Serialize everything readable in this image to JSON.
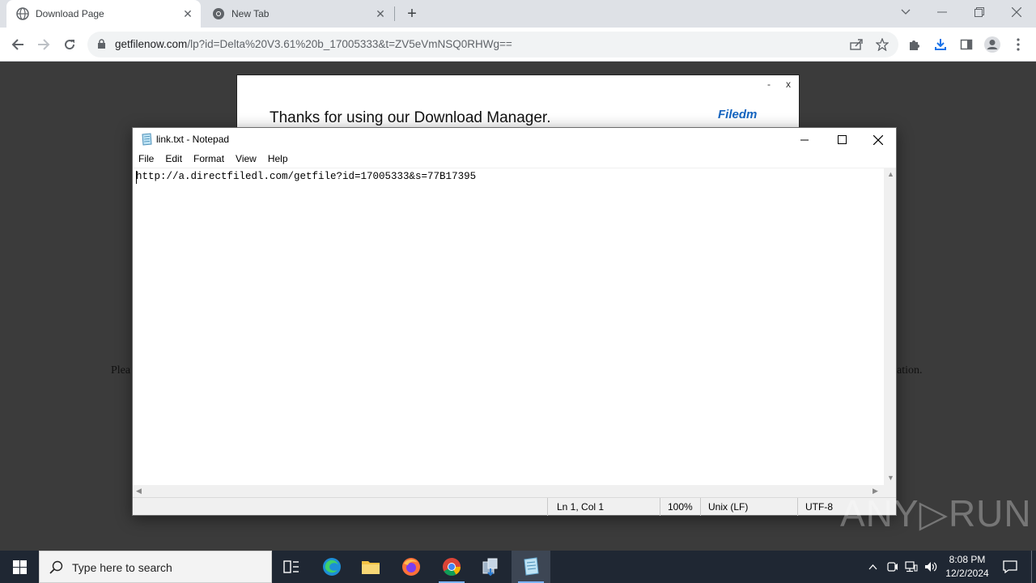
{
  "browser": {
    "tabs": [
      {
        "title": "Download Page",
        "active": true
      },
      {
        "title": "New Tab",
        "active": false
      }
    ],
    "url_domain": "getfilenow.com",
    "url_rest": "/lp?id=Delta%20V3.61%20b_17005333&t=ZV5eVmNSQ0RHWg=="
  },
  "page": {
    "promo_text": "Thanks for using our Download Manager.",
    "promo_logo": "Filedm",
    "promo_min": "-",
    "promo_close": "x",
    "bg_text_left": "Plea",
    "bg_text_right": "ation."
  },
  "notepad": {
    "title": "link.txt - Notepad",
    "menu": [
      "File",
      "Edit",
      "Format",
      "View",
      "Help"
    ],
    "content": "http://a.directfiledl.com/getfile?id=17005333&s=77B17395",
    "status": {
      "position": "Ln 1, Col 1",
      "zoom": "100%",
      "line_ending": "Unix (LF)",
      "encoding": "UTF-8"
    }
  },
  "watermark": "ANY▷RUN",
  "taskbar": {
    "search_placeholder": "Type here to search",
    "time": "8:08 PM",
    "date": "12/2/2024"
  }
}
